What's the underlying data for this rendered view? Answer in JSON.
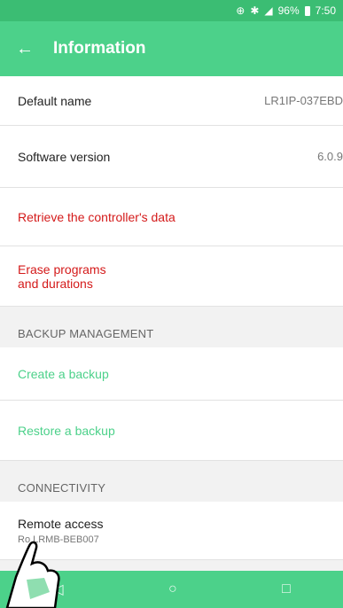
{
  "status_bar": {
    "battery": "96%",
    "time": "7:50",
    "icons": [
      "sync-icon",
      "bluetooth-icon",
      "signal-icon",
      "battery-icon"
    ]
  },
  "app_bar": {
    "title": "Information",
    "back_icon": "back-arrow-icon"
  },
  "rows": {
    "default_name": {
      "label": "Default name",
      "value": "LR1IP-037EBD"
    },
    "software_version": {
      "label": "Software version",
      "value": "6.0.9"
    },
    "retrieve": {
      "label": "Retrieve the controller's data"
    },
    "erase": {
      "line1": "Erase programs",
      "line2": "and durations"
    }
  },
  "sections": {
    "backup": "BACKUP MANAGEMENT",
    "connectivity": "CONNECTIVITY"
  },
  "backup": {
    "create": "Create a backup",
    "restore": "Restore a backup"
  },
  "connectivity": {
    "remote_access": "Remote access",
    "remote_sub": "Ro    LRMB-BEB007"
  },
  "nav": {
    "icons": [
      "back-nav-icon",
      "home-nav-icon",
      "recents-nav-icon"
    ]
  },
  "colors": {
    "accent": "#4cd18a",
    "status": "#3bbd73",
    "danger": "#d41a1a"
  }
}
